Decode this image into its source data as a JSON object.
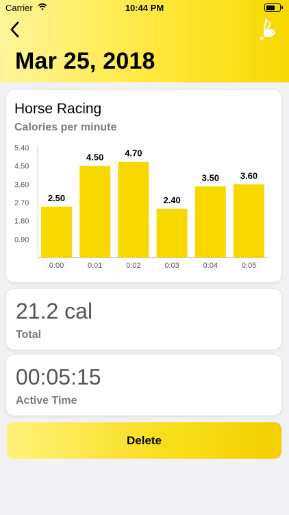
{
  "status_bar": {
    "carrier": "Carrier",
    "time": "10:44 PM"
  },
  "header": {
    "date": "Mar 25, 2018"
  },
  "chart_data": {
    "type": "bar",
    "title": "Horse Racing",
    "subtitle": "Calories per minute",
    "categories": [
      "0:00",
      "0:01",
      "0:02",
      "0:03",
      "0:04",
      "0:05"
    ],
    "values": [
      2.5,
      4.5,
      4.7,
      2.4,
      3.5,
      3.6
    ],
    "value_labels": [
      "2.50",
      "4.50",
      "4.70",
      "2.40",
      "3.50",
      "3.60"
    ],
    "yticks": [
      "5.40",
      "4.50",
      "3.60",
      "2.70",
      "1.80",
      "0.90"
    ],
    "ylim": [
      0,
      5.4
    ],
    "bar_color": "#f7d800",
    "grid": false
  },
  "total": {
    "value": "21.2 cal",
    "label": "Total"
  },
  "active_time": {
    "value": "00:05:15",
    "label": "Active Time"
  },
  "delete_label": "Delete",
  "colors": {
    "accent": "#f7d800",
    "header_gradient_start": "#fff59a"
  }
}
